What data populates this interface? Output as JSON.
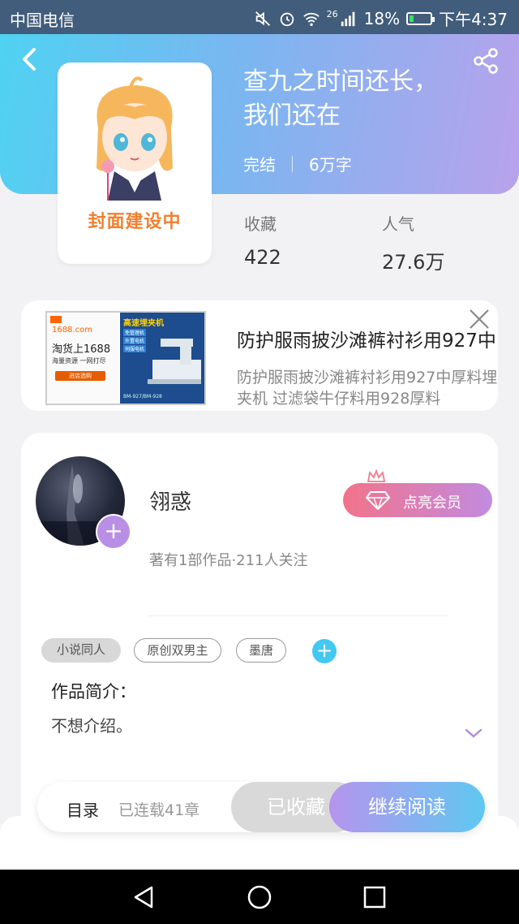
{
  "status_bar": {
    "carrier": "中国电信",
    "network": "26",
    "battery_percent": "18%",
    "battery_level": 0.18,
    "time": "下午4:37"
  },
  "book": {
    "cover_text": "封面建设中",
    "title_line1": "查九之时间还长，",
    "title_line2": "我们还在",
    "status": "完结",
    "word_count": "6万字",
    "favorites_label": "收藏",
    "favorites_value": "422",
    "popularity_label": "人气",
    "popularity_value": "27.6万"
  },
  "ad": {
    "title": "防护服雨披沙滩裤衬衫用927中",
    "description": "防护服雨披沙滩裤衬衫用927中厚料埋夹机 过滤袋牛仔料用928厚料",
    "image_site": "1688.com",
    "image_headline": "淘货上1688",
    "image_sub": "海量资源 一网打尽",
    "image_cta": "进店选购",
    "image_product": "高速埋夹机",
    "image_feature1": "免管理机",
    "image_feature2": "外置电机",
    "image_feature3": "伺服电机",
    "image_model": "BM-927/BM-928"
  },
  "author": {
    "name": "翎惑",
    "info": "著有1部作品·211人关注",
    "vip_label": "点亮会员",
    "follow_symbol": "+"
  },
  "tags": [
    "小说同人",
    "原创双男主",
    "墨唐"
  ],
  "intro": {
    "heading": "作品简介：",
    "text": "不想介绍。"
  },
  "bottom_bar": {
    "catalog_label": "目录",
    "chapter_count": "已连载41章",
    "collected_label": "已收藏",
    "read_label": "继续阅读"
  }
}
